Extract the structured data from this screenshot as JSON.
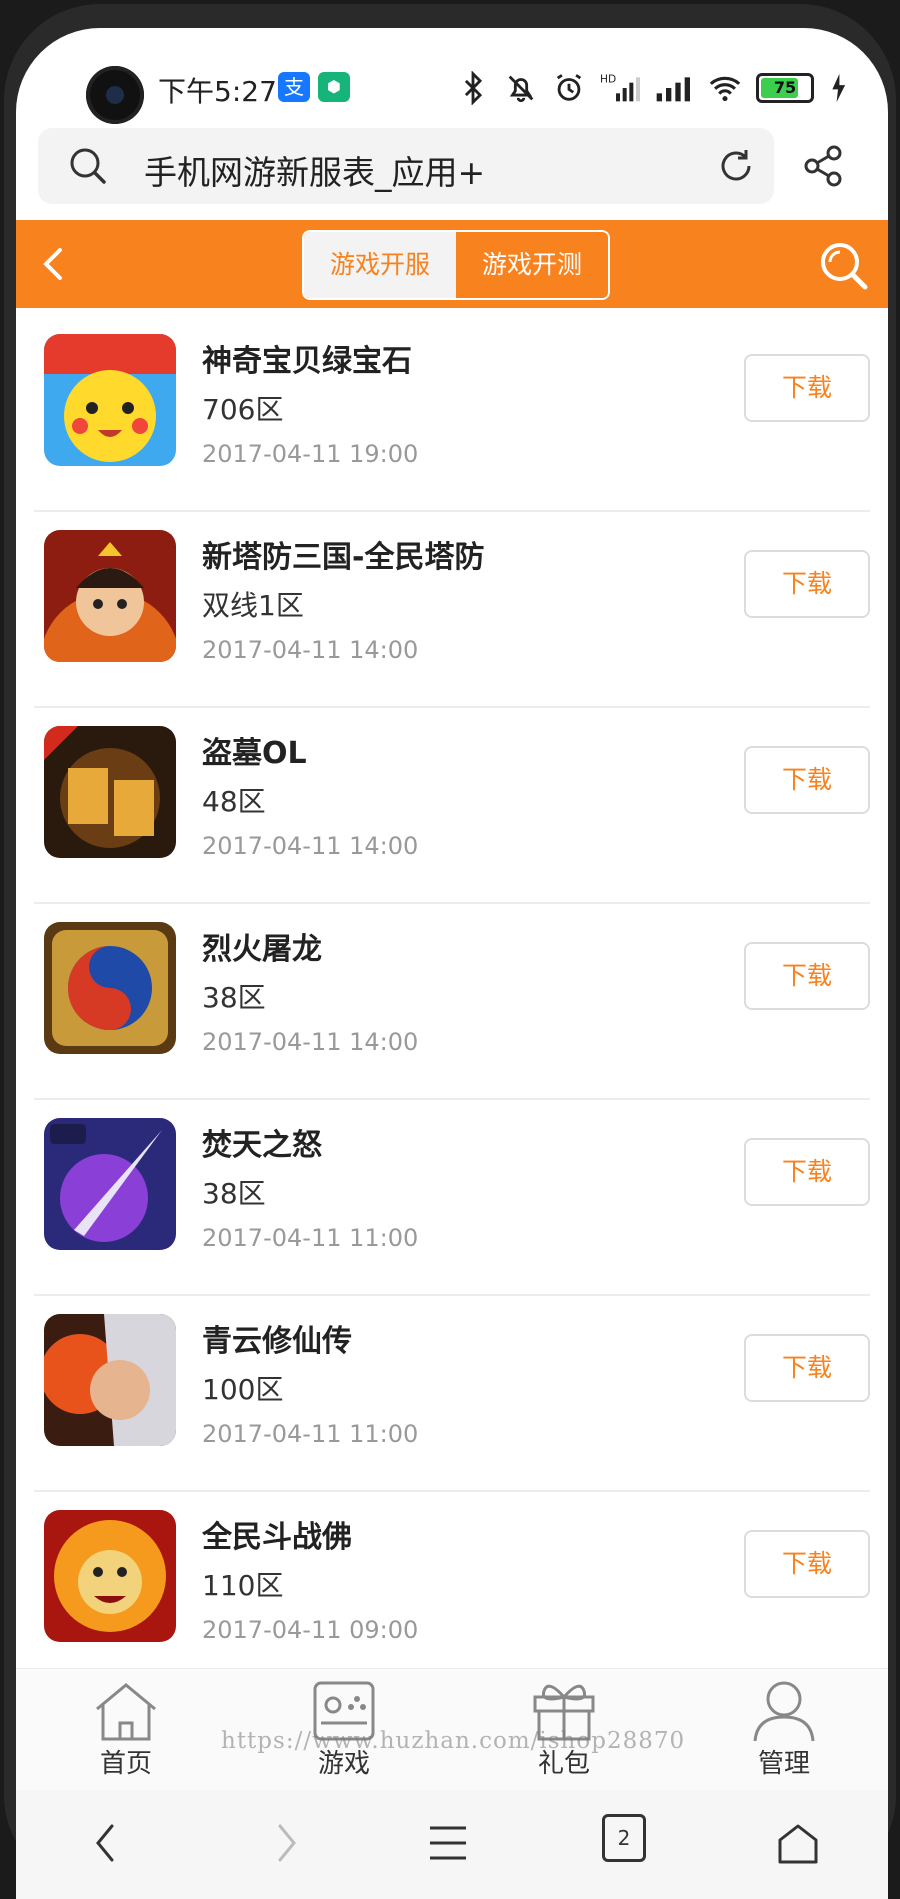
{
  "status_bar": {
    "time": "下午5:27",
    "app_badges": [
      "支",
      "⬢"
    ],
    "battery_level": "75"
  },
  "browser": {
    "address_title": "手机网游新服表_应用+"
  },
  "header": {
    "tabs": [
      {
        "label": "游戏开服",
        "active": true
      },
      {
        "label": "游戏开测",
        "active": false
      }
    ]
  },
  "games": [
    {
      "name": "神奇宝贝绿宝石",
      "zone": "706区",
      "time": "2017-04-11 19:00",
      "button": "下载",
      "icon": "pikachu-icon"
    },
    {
      "name": "新塔防三国-全民塔防",
      "zone": "双线1区",
      "time": "2017-04-11 14:00",
      "button": "下载",
      "icon": "warrior-icon"
    },
    {
      "name": "盗墓OL",
      "zone": "48区",
      "time": "2017-04-11 14:00",
      "button": "下载",
      "icon": "daomu-icon"
    },
    {
      "name": "烈火屠龙",
      "zone": "38区",
      "time": "2017-04-11 14:00",
      "button": "下载",
      "icon": "taiji-icon"
    },
    {
      "name": "焚天之怒",
      "zone": "38区",
      "time": "2017-04-11 11:00",
      "button": "下载",
      "icon": "sword-icon"
    },
    {
      "name": "青云修仙传",
      "zone": "100区",
      "time": "2017-04-11 11:00",
      "button": "下载",
      "icon": "hero-icon"
    },
    {
      "name": "全民斗战佛",
      "zone": "110区",
      "time": "2017-04-11 09:00",
      "button": "下载",
      "icon": "monkey-king-icon"
    }
  ],
  "tabbar": {
    "items": [
      {
        "label": "首页",
        "icon": "home-icon"
      },
      {
        "label": "游戏",
        "icon": "gamepad-icon"
      },
      {
        "label": "礼包",
        "icon": "gift-icon"
      },
      {
        "label": "管理",
        "icon": "user-icon"
      }
    ]
  },
  "watermark": "https://www.huzhan.com/ishop28870",
  "system_nav": {
    "tab_count": "2"
  },
  "colors": {
    "accent": "#f7821e",
    "text": "#222222",
    "muted": "#999999"
  }
}
